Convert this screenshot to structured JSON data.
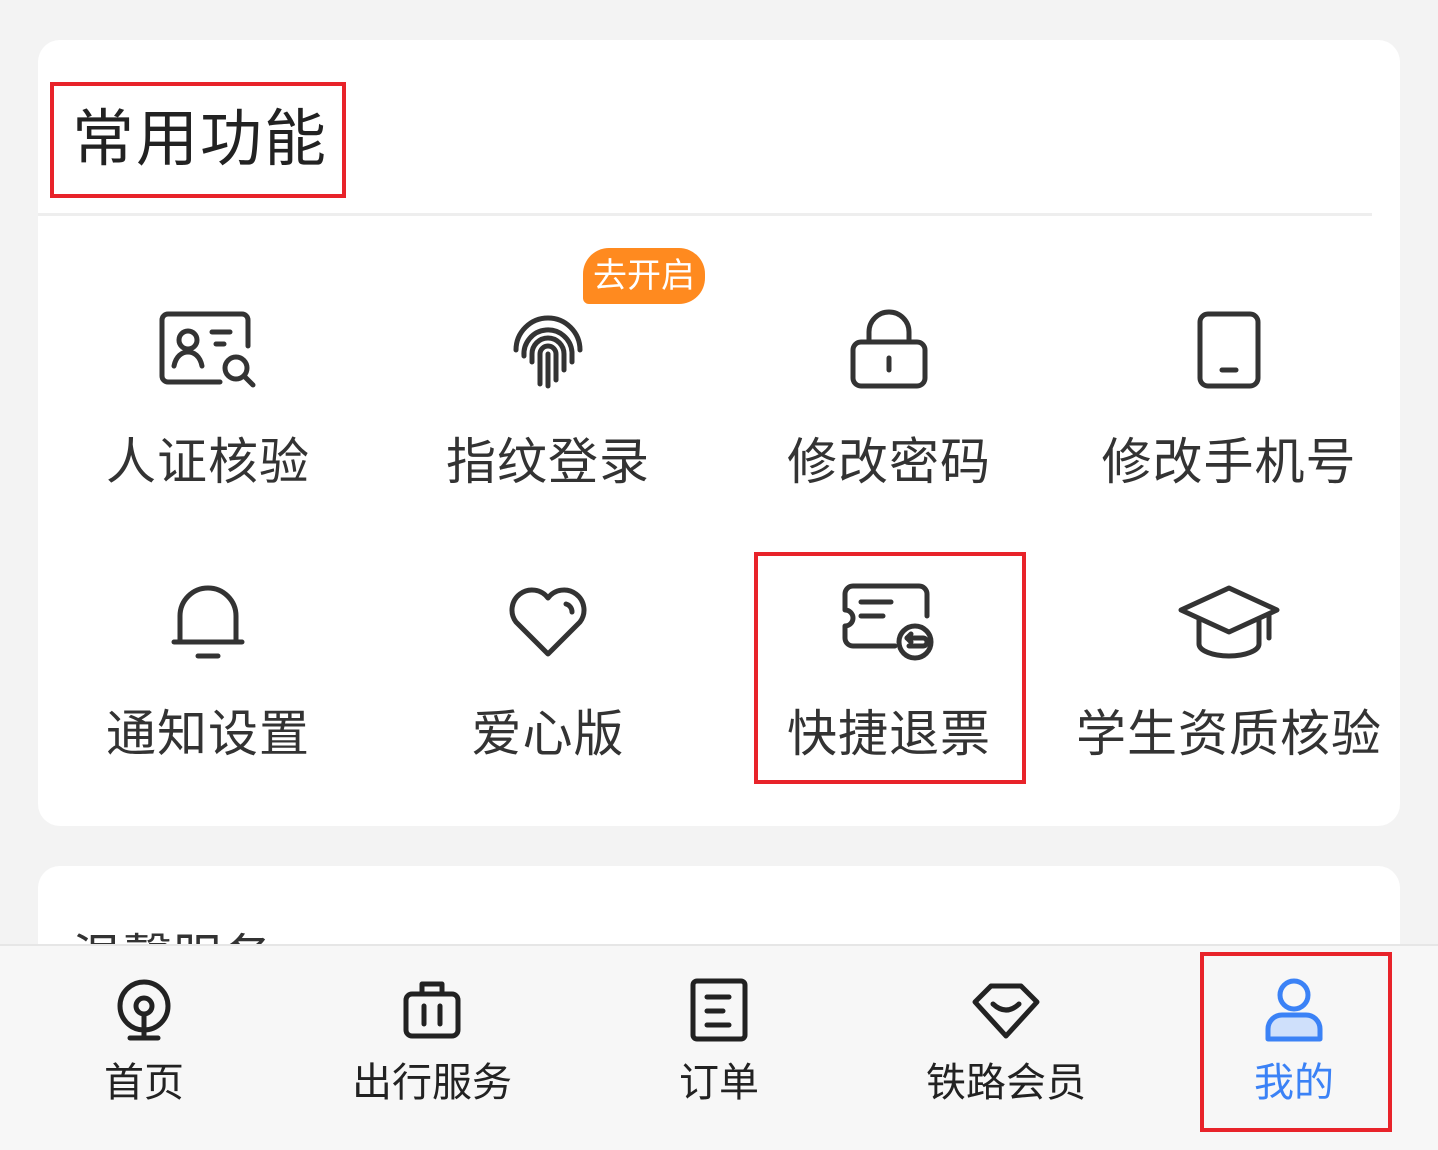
{
  "common": {
    "title": "常用功能",
    "items": [
      {
        "label": "人证核验",
        "icon": "id-card-search-icon"
      },
      {
        "label": "指纹登录",
        "icon": "fingerprint-icon"
      },
      {
        "label": "修改密码",
        "icon": "lock-icon"
      },
      {
        "label": "修改手机号",
        "icon": "phone-icon"
      },
      {
        "label": "通知设置",
        "icon": "bell-icon"
      },
      {
        "label": "爱心版",
        "icon": "heart-icon"
      },
      {
        "label": "快捷退票",
        "icon": "ticket-refund-icon"
      },
      {
        "label": "学生资质核验",
        "icon": "graduation-cap-icon"
      }
    ],
    "fingerprint_badge": "去开启"
  },
  "second_section": {
    "title": "温馨服务"
  },
  "tabbar": {
    "items": [
      {
        "label": "首页",
        "icon": "railway-logo-icon"
      },
      {
        "label": "出行服务",
        "icon": "luggage-icon"
      },
      {
        "label": "订单",
        "icon": "order-list-icon"
      },
      {
        "label": "铁路会员",
        "icon": "diamond-icon"
      },
      {
        "label": "我的",
        "icon": "user-icon"
      }
    ],
    "active_index": 4
  },
  "colors": {
    "accent": "#3b82f6",
    "badge": "#ff8a1f",
    "highlight": "#e8232a",
    "icon_stroke": "#333333"
  }
}
